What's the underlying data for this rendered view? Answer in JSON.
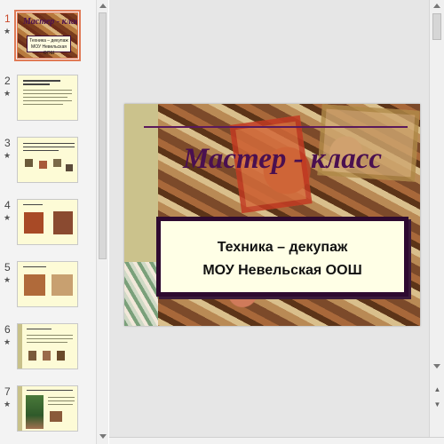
{
  "thumbnails": {
    "star_glyph": "★",
    "items": [
      {
        "number": "1",
        "title": "Мастер - класс",
        "subtitle_line1": "Техника – декупаж",
        "subtitle_line2": "МОУ Невельская ООШ"
      },
      {
        "number": "2"
      },
      {
        "number": "3"
      },
      {
        "number": "4"
      },
      {
        "number": "5"
      },
      {
        "number": "6"
      },
      {
        "number": "7"
      }
    ],
    "selected_index": 0
  },
  "slide": {
    "title": "Мастер - класс",
    "subtitle_line1": "Техника – декупаж",
    "subtitle_line2": "МОУ Невельская ООШ",
    "colors": {
      "title": "#4a1050",
      "box_border": "#2e0a30",
      "box_fill": "#ffffe6",
      "accent_selected": "#e07a56"
    }
  },
  "scrollbar": {
    "prev_slide_glyph": "▲",
    "next_slide_glyph": "▼"
  }
}
